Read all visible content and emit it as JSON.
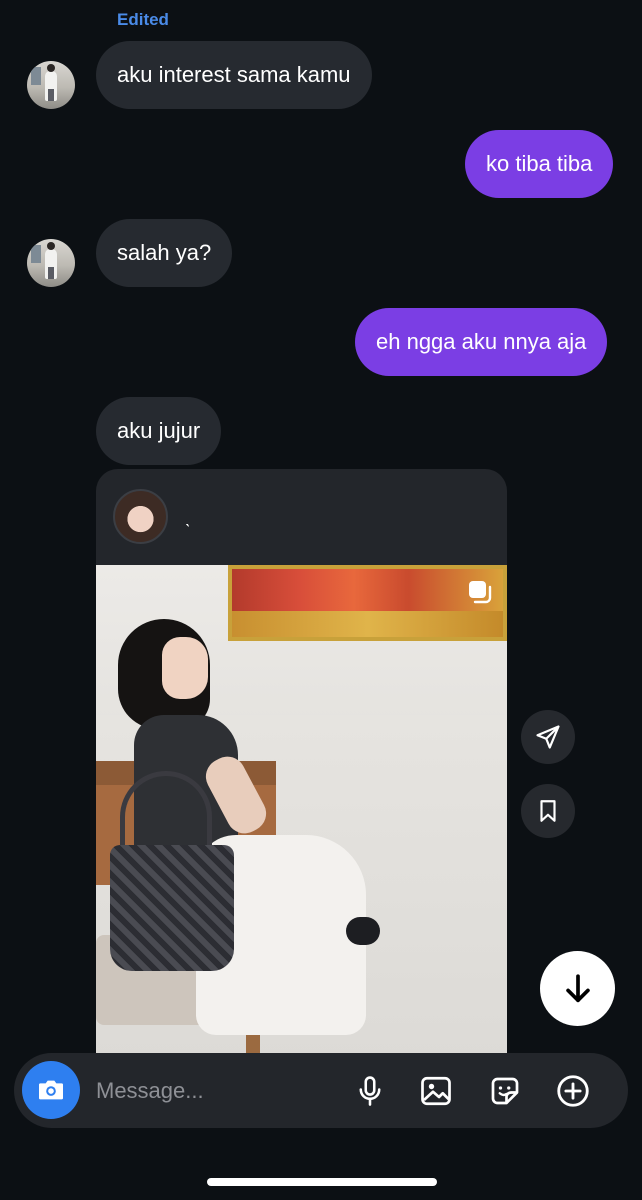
{
  "chat": {
    "edited_label": "Edited",
    "messages": [
      {
        "direction": "incoming",
        "text": "aku interest sama kamu"
      },
      {
        "direction": "outgoing",
        "text": "ko tiba tiba"
      },
      {
        "direction": "incoming",
        "text": "salah ya?"
      },
      {
        "direction": "outgoing",
        "text": "eh ngga aku nnya aja"
      },
      {
        "direction": "incoming",
        "text": "aku jujur"
      }
    ],
    "shared_post": {
      "username": "ˎ"
    }
  },
  "composer": {
    "placeholder": "Message..."
  },
  "colors": {
    "background": "#0c1014",
    "incoming_bubble": "#262a30",
    "outgoing_bubble": "#7b3ee4",
    "edited_label": "#4a8be8",
    "camera_button": "#2e7ff0"
  },
  "icons": {
    "share": "send-icon",
    "save": "bookmark-icon",
    "scroll": "arrow-down-icon",
    "camera": "camera-icon",
    "mic": "microphone-icon",
    "gallery": "image-icon",
    "sticker": "sticker-icon",
    "more": "plus-circle-icon",
    "carousel": "carousel-icon"
  }
}
